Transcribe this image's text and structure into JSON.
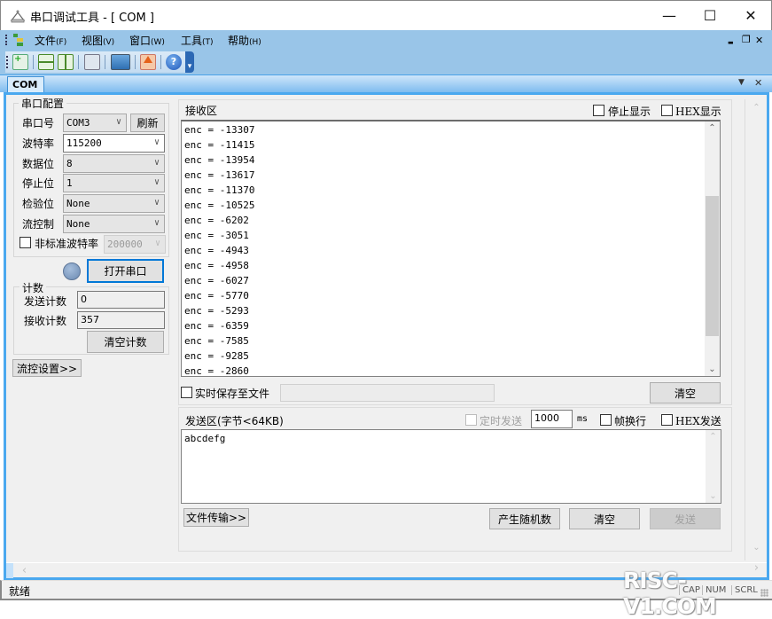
{
  "window": {
    "title": "串口调试工具 - [ COM ]",
    "minimize_glyph": "—",
    "maximize_glyph": "☐",
    "close_glyph": "✕"
  },
  "menubar": {
    "items": [
      {
        "label": "文件",
        "accel": "(F)"
      },
      {
        "label": "视图",
        "accel": "(V)"
      },
      {
        "label": "窗口",
        "accel": "(W)"
      },
      {
        "label": "工具",
        "accel": "(T)"
      },
      {
        "label": "帮助",
        "accel": "(H)"
      }
    ],
    "mdi_minimize": "▬",
    "mdi_restore": "❐",
    "mdi_close": "✕"
  },
  "toolbar": {
    "icons": [
      "new-window-icon",
      "horizontal-split-icon",
      "vertical-split-icon",
      "calculator-icon",
      "device-manager-icon",
      "upload-icon",
      "help-icon"
    ],
    "overflow_glyph": "▾"
  },
  "tabs": [
    {
      "label": "COM",
      "active": true
    }
  ],
  "tab_controls": {
    "dropdown": "▼",
    "close": "✕"
  },
  "serial_config": {
    "group_title": "串口配置",
    "port_label": "串口号",
    "port_value": "COM3",
    "refresh_label": "刷新",
    "baud_label": "波特率",
    "baud_value": "115200",
    "databits_label": "数据位",
    "databits_value": "8",
    "stopbits_label": "停止位",
    "stopbits_value": "1",
    "parity_label": "检验位",
    "parity_value": "None",
    "flow_label": "流控制",
    "flow_value": "None",
    "custom_baud_label": "非标准波特率",
    "custom_baud_checked": false,
    "custom_baud_value": "200000",
    "open_port_label": "打开串口",
    "status_led_color": "#7c9cc4"
  },
  "counter": {
    "group_title": "计数",
    "sent_label": "发送计数",
    "sent_value": "0",
    "recv_label": "接收计数",
    "recv_value": "357",
    "clear_label": "清空计数"
  },
  "flow_settings_label": "流控设置>>",
  "receive": {
    "title": "接收区",
    "stop_display_label": "停止显示",
    "stop_display_checked": false,
    "hex_display_label": "HEX显示",
    "hex_display_checked": false,
    "lines": [
      "enc = -13307",
      "enc = -11415",
      "enc = -13954",
      "enc = -13617",
      "enc = -11370",
      "enc = -10525",
      "enc = -6202",
      "enc = -3051",
      "enc = -4943",
      "enc = -4958",
      "enc = -6027",
      "enc = -5770",
      "enc = -5293",
      "enc = -6359",
      "enc = -7585",
      "enc = -9285",
      "enc = -2860"
    ],
    "save_to_file_label": "实时保存至文件",
    "save_to_file_checked": false,
    "file_path": "",
    "clear_label": "清空"
  },
  "send": {
    "title": "发送区(字节<64KB)",
    "timed_send_label": "定时发送",
    "timed_send_checked": false,
    "interval_value": "1000",
    "interval_unit": "ms",
    "frame_newline_label": "帧换行",
    "frame_newline_checked": false,
    "hex_send_label": "HEX发送",
    "hex_send_checked": false,
    "text": "abcdefg",
    "file_transfer_label": "文件传输>>",
    "random_label": "产生随机数",
    "clear_label": "清空",
    "send_label": "发送"
  },
  "statusbar": {
    "status": "就绪",
    "cap": "CAP",
    "num": "NUM",
    "scrl": "SCRL"
  },
  "watermark": "RISC-V1.COM"
}
